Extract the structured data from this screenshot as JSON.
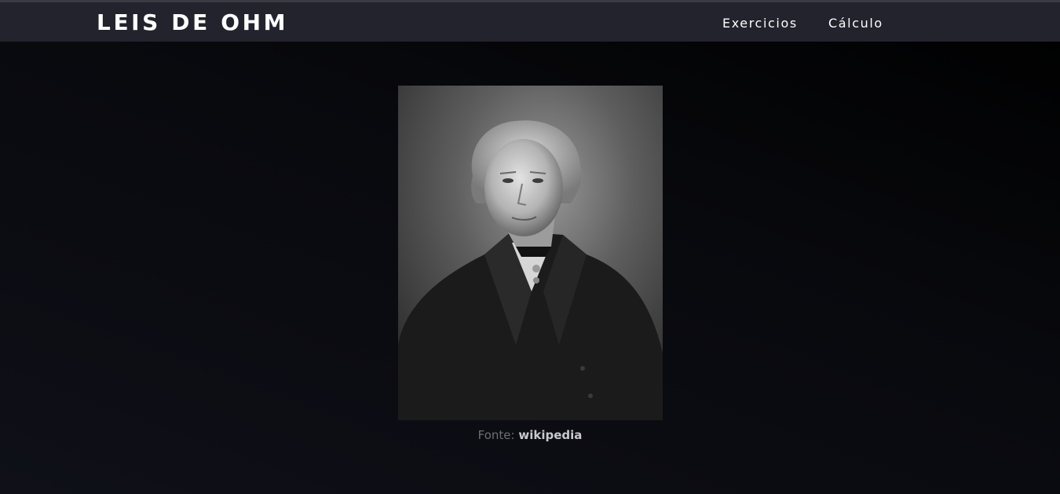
{
  "header": {
    "title": "LEIS DE OHM",
    "nav": [
      {
        "label": "Exercicios"
      },
      {
        "label": "Cálculo"
      }
    ]
  },
  "main": {
    "caption": {
      "prefix": "Fonte:",
      "link": "wikipedia"
    }
  },
  "colors": {
    "header_bg": "#22232c",
    "page_bg": "#0c0d13",
    "caption_muted": "#6d6e76",
    "caption_link": "#c9cad0"
  }
}
